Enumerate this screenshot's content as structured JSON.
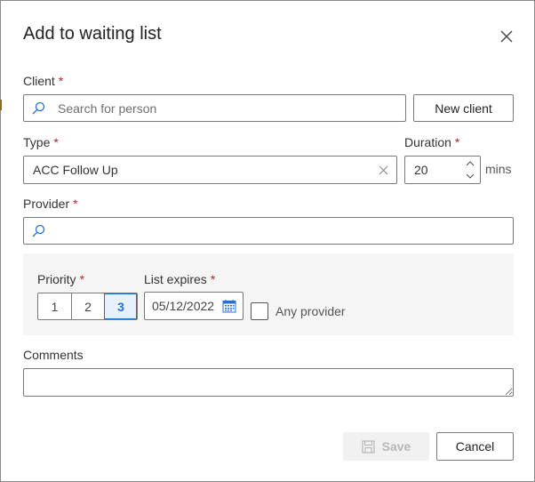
{
  "dialog": {
    "title": "Add to waiting list",
    "close_icon": "close-icon"
  },
  "client": {
    "label": "Client",
    "required": "*",
    "placeholder": "Search for person",
    "value": "",
    "new_client_label": "New client"
  },
  "type": {
    "label": "Type",
    "required": "*",
    "value": "ACC Follow Up",
    "clear_icon": "clear-icon"
  },
  "duration": {
    "label": "Duration",
    "required": "*",
    "value": "20",
    "unit": "mins"
  },
  "provider": {
    "label": "Provider",
    "required": "*",
    "value": ""
  },
  "priority": {
    "label": "Priority",
    "required": "*",
    "options": [
      "1",
      "2",
      "3"
    ],
    "selected": "3"
  },
  "list_expires": {
    "label": "List expires",
    "required": "*",
    "value": "05/12/2022"
  },
  "any_provider": {
    "label": "Any provider",
    "checked": false
  },
  "comments": {
    "label": "Comments",
    "value": ""
  },
  "footer": {
    "save_label": "Save",
    "cancel_label": "Cancel"
  },
  "colors": {
    "accent": "#1f6fd1",
    "required": "#b5262b",
    "panel_bg": "#f5f5f5"
  }
}
